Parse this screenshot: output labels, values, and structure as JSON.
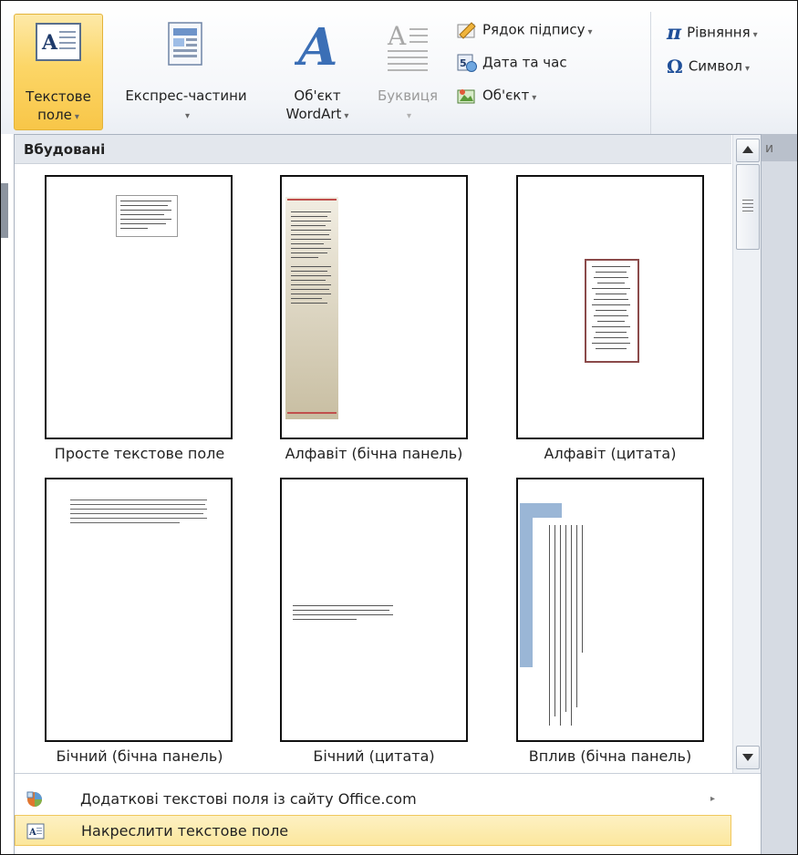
{
  "ribbon": {
    "text_box": {
      "line1": "Текстове",
      "line2": "поле"
    },
    "quick_parts": {
      "label": "Експрес-частини"
    },
    "wordart": {
      "line1": "Об'єкт",
      "line2": "WordArt"
    },
    "drop_cap": {
      "label": "Буквиця"
    },
    "signature_line": {
      "label": "Рядок підпису"
    },
    "date_time": {
      "label": "Дата та час"
    },
    "object": {
      "label": "Об'єкт"
    },
    "equation": {
      "label": "Рівняння"
    },
    "symbol": {
      "label": "Символ"
    },
    "group_fragment": "и",
    "caret": "▾"
  },
  "gallery": {
    "header": "Вбудовані",
    "items": [
      {
        "label": "Просте текстове поле"
      },
      {
        "label": "Алфавіт (бічна панель)"
      },
      {
        "label": "Алфавіт (цитата)"
      },
      {
        "label": "Бічний (бічна панель)"
      },
      {
        "label": "Бічний (цитата)"
      },
      {
        "label": "Вплив (бічна панель)"
      }
    ]
  },
  "commands": {
    "more_from_office": "Додаткові текстові поля із сайту Office.com",
    "draw_text_box": "Накреслити текстове поле",
    "submenu_arrow": "▸"
  },
  "colors": {
    "accent": "#fcd667",
    "highlight": "#fce79d",
    "header_bg": "#e3e7ed"
  }
}
